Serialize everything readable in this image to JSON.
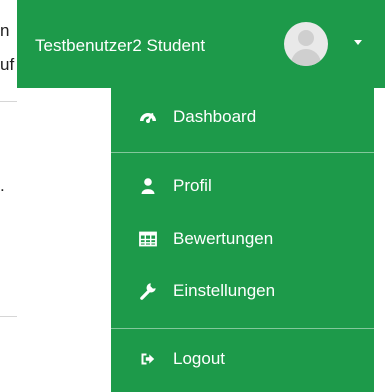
{
  "background": {
    "fragment_1": "n",
    "fragment_2": "uf",
    "fragment_3": "."
  },
  "navbar": {
    "user_name": "Testbenutzer2 Student"
  },
  "dropdown": {
    "items": [
      {
        "label": "Dashboard",
        "icon": "dashboard-icon"
      },
      {
        "label": "Profil",
        "icon": "user-icon"
      },
      {
        "label": "Bewertungen",
        "icon": "table-icon"
      },
      {
        "label": "Einstellungen",
        "icon": "wrench-icon"
      },
      {
        "label": "Logout",
        "icon": "logout-icon"
      }
    ]
  },
  "colors": {
    "accent": "#1d9a4a",
    "text_on_accent": "#ffffff"
  }
}
